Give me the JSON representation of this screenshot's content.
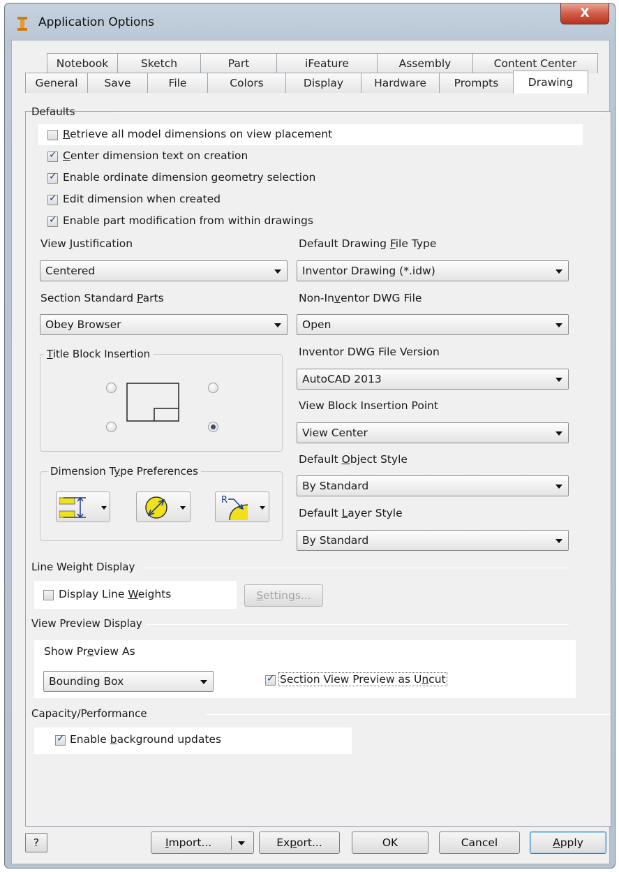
{
  "window": {
    "title": "Application Options",
    "close_label": "X"
  },
  "tabs_row1": [
    "Notebook",
    "Sketch",
    "Part",
    "iFeature",
    "Assembly",
    "Content Center"
  ],
  "tabs_row2": [
    "General",
    "Save",
    "File",
    "Colors",
    "Display",
    "Hardware",
    "Prompts",
    "Drawing"
  ],
  "active_tab": "Drawing",
  "defaults": {
    "title": "Defaults",
    "checkboxes": [
      {
        "pre": "",
        "u": "R",
        "post": "etrieve all model dimensions on view placement",
        "checked": false
      },
      {
        "pre": "",
        "u": "C",
        "post": "enter dimension text on creation",
        "checked": true
      },
      {
        "pre": "Enable ordinate dimension ",
        "u": "g",
        "post": "eometry selection",
        "checked": true
      },
      {
        "pre": "Edit dimension when created",
        "u": "",
        "post": "",
        "checked": true
      },
      {
        "pre": "Enable part modification from within drawings",
        "u": "",
        "post": "",
        "checked": true
      }
    ]
  },
  "view_justification": {
    "pre": "View ",
    "u": "J",
    "post": "ustification",
    "value": "Centered"
  },
  "default_drawing_file_type": {
    "pre": "Default Drawing ",
    "u": "F",
    "post": "ile Type",
    "value": "Inventor Drawing (*.idw)"
  },
  "section_standard_parts": {
    "pre": "Section Standard ",
    "u": "P",
    "post": "arts",
    "value": "Obey Browser"
  },
  "non_inventor_dwg": {
    "pre": "Non-In",
    "u": "v",
    "post": "entor DWG File",
    "value": "Open"
  },
  "inventor_dwg_version": {
    "label": "Inventor DWG File Version",
    "value": "AutoCAD 2013"
  },
  "view_block_insertion": {
    "label": "View Block Insertion Point",
    "value": "View Center"
  },
  "default_object_style": {
    "pre": "Default ",
    "u": "O",
    "post": "bject Style",
    "value": "By Standard"
  },
  "default_layer_style": {
    "pre": "Default ",
    "u": "L",
    "post": "ayer Style",
    "value": "By Standard"
  },
  "title_block": {
    "pre": "",
    "u": "T",
    "post": "itle Block Insertion",
    "selected": "bottom-right"
  },
  "dimension_prefs": {
    "pre": "Dimension T",
    "u": "y",
    "post": "pe Preferences"
  },
  "line_weight": {
    "title": "Line Weight Display",
    "checkbox": {
      "pre": "Display Line ",
      "u": "W",
      "post": "eights",
      "checked": false
    },
    "settings": {
      "pre": "",
      "u": "S",
      "post": "ettings..."
    }
  },
  "view_preview": {
    "title": "View Preview Display",
    "show_as": {
      "pre": "Show Pr",
      "u": "e",
      "post": "view As",
      "value": "Bounding Box"
    },
    "section_uncut": {
      "pre": "Section View Preview as U",
      "u": "n",
      "post": "cut",
      "checked": true
    }
  },
  "capacity": {
    "title": "Capacity/Performance",
    "checkbox": {
      "pre": "Enable ",
      "u": "b",
      "post": "ackground updates",
      "checked": true
    }
  },
  "buttons": {
    "help": "?",
    "import": {
      "pre": "",
      "u": "I",
      "post": "mport..."
    },
    "export": {
      "pre": "Ex",
      "u": "p",
      "post": "ort..."
    },
    "ok": "OK",
    "cancel": "Cancel",
    "apply": {
      "pre": "",
      "u": "A",
      "post": "pply"
    }
  },
  "colors": {
    "accent": "#3c7fb1",
    "checkmark": "#1c3f76",
    "icon_yellow": "#f2e019"
  }
}
